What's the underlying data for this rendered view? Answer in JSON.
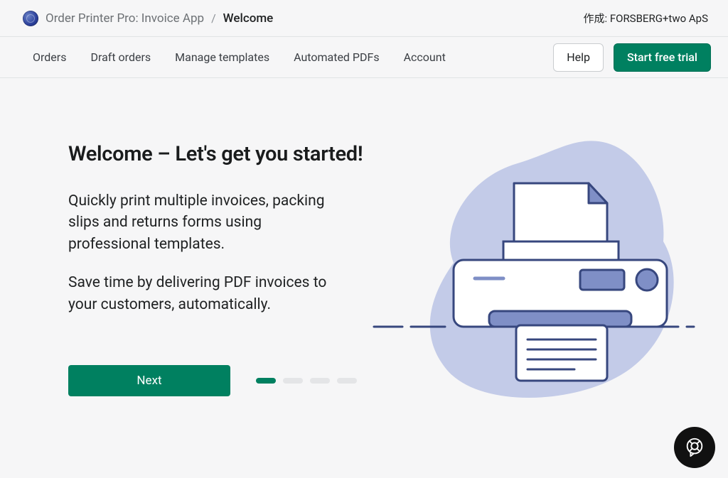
{
  "header": {
    "app_name": "Order Printer Pro: Invoice App",
    "separator": "/",
    "current_page": "Welcome",
    "creator_prefix": "作成:",
    "creator_name": "FORSBERG+two ApS"
  },
  "nav": {
    "items": [
      "Orders",
      "Draft orders",
      "Manage templates",
      "Automated PDFs",
      "Account"
    ],
    "help_label": "Help",
    "trial_label": "Start free trial"
  },
  "welcome": {
    "heading": "Welcome – Let's get you started!",
    "paragraph1": "Quickly print multiple invoices, packing slips and returns forms using professional templates.",
    "paragraph2": "Save time by delivering PDF invoices to your customers, automatically.",
    "next_label": "Next",
    "step_count": 4,
    "active_step": 0
  },
  "colors": {
    "primary": "#008060",
    "illus_blue": "#c3cbe8",
    "illus_line": "#37477e"
  },
  "icons": {
    "app_logo": "order-printer-pro-logo",
    "chat": "life-ring-chat-icon"
  }
}
